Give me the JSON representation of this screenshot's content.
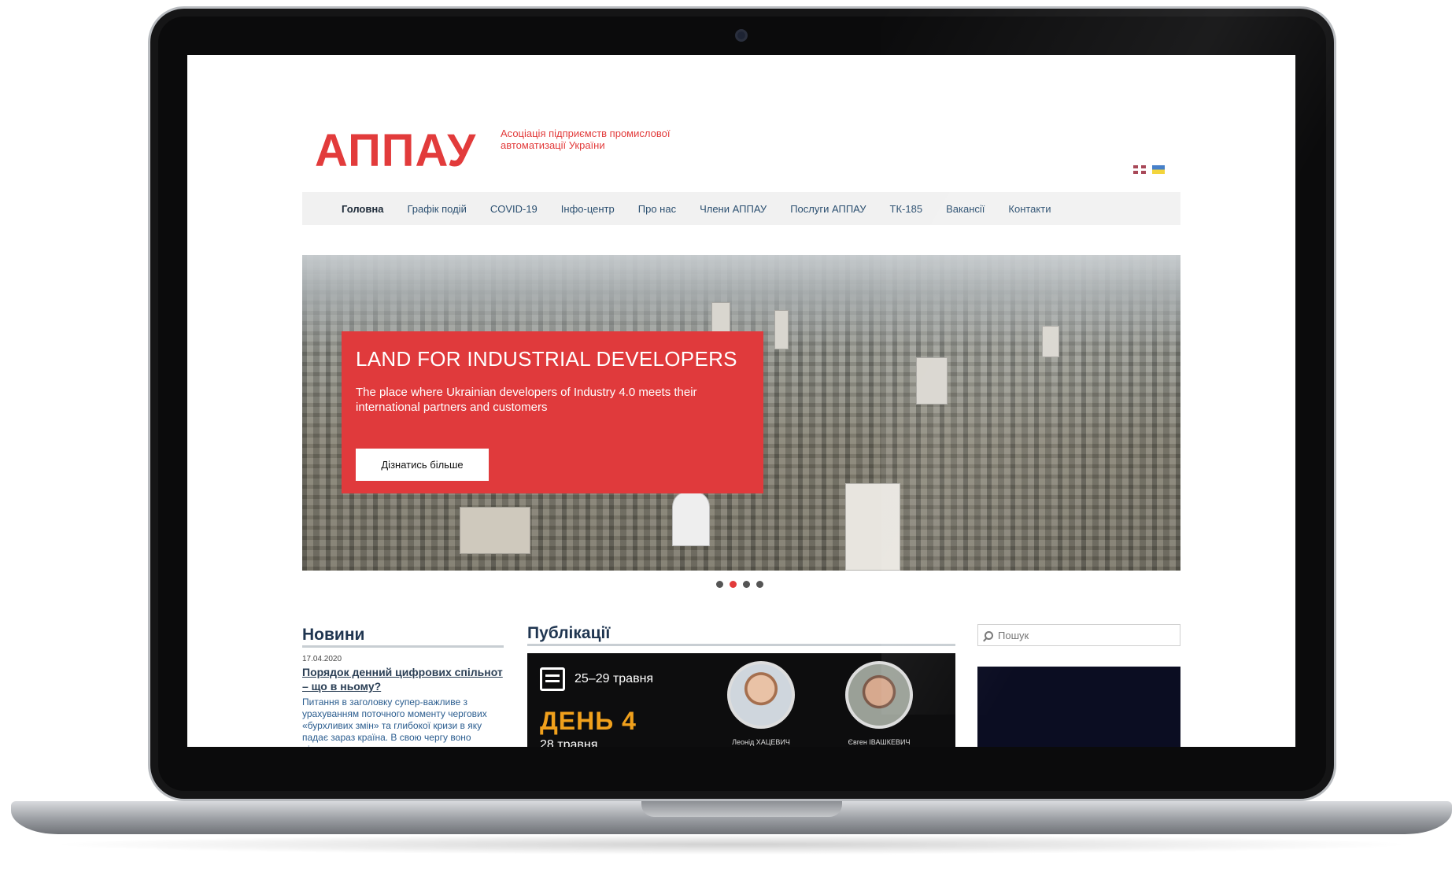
{
  "site": {
    "logo": "АППАУ",
    "tagline": "Асоціація підприємств промислової автоматизації України"
  },
  "nav": {
    "items": [
      {
        "label": "Головна",
        "active": true
      },
      {
        "label": "Графік подій",
        "active": false
      },
      {
        "label": "COVID-19",
        "active": false
      },
      {
        "label": "Інфо-центр",
        "active": false
      },
      {
        "label": "Про нас",
        "active": false
      },
      {
        "label": "Члени АППАУ",
        "active": false
      },
      {
        "label": "Послуги АППАУ",
        "active": false
      },
      {
        "label": "ТК-185",
        "active": false
      },
      {
        "label": "Вакансії",
        "active": false
      },
      {
        "label": "Контакти",
        "active": false
      }
    ]
  },
  "hero": {
    "title": "LAND FOR INDUSTRIAL DEVELOPERS",
    "text": "The place where Ukrainian developers of Industry 4.0 meets their international partners and customers",
    "button": "Дізнатись більше",
    "slide_count": 4,
    "active_slide": 2
  },
  "news": {
    "heading": "Новини",
    "date": "17.04.2020",
    "title": "Порядок денний цифрових спільнот – що в ньому?",
    "text": "Питання в заголовку супер-важливе з урахуванням поточного моменту чергових «бурхливих змін» та глибокої кризи в яку падає зараз країна. В свою чергу воно ділиться на"
  },
  "publications": {
    "heading": "Публікації",
    "dates": "25–29 травня",
    "day": "ДЕНЬ 4",
    "subday": "28 травня",
    "speaker_1": "Леонід ХАЦЕВИЧ",
    "speaker_2": "Євген ІВАШКЕВИЧ"
  },
  "search": {
    "placeholder": "Пошук"
  },
  "colors": {
    "brand_red": "#e23b3b",
    "nav_text": "#2b4f70",
    "accent_orange": "#f0a01c"
  }
}
